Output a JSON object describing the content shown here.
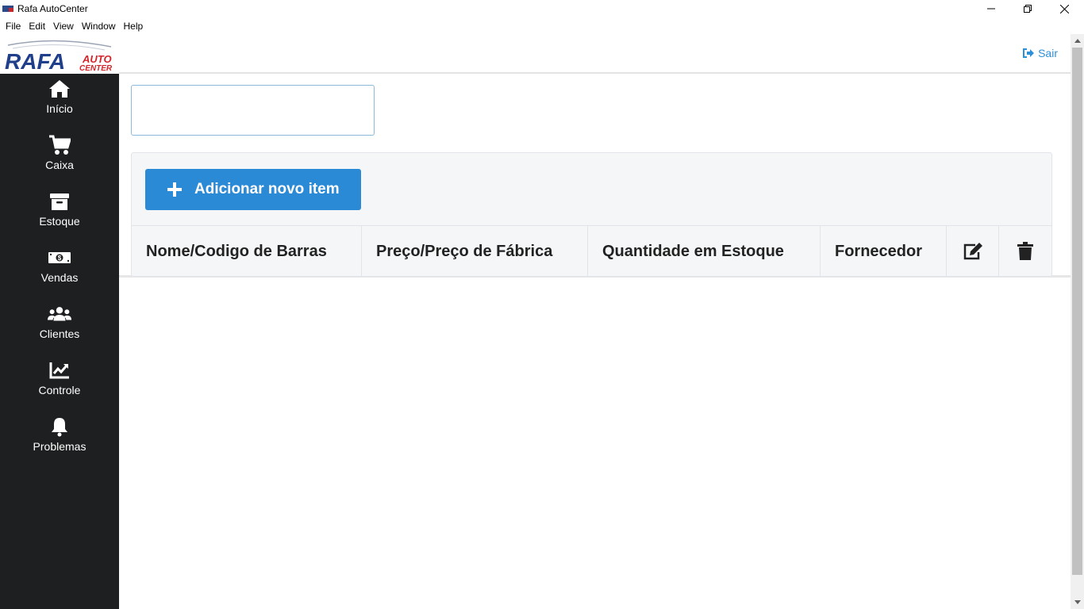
{
  "window": {
    "title": "Rafa AutoCenter"
  },
  "menu": [
    "File",
    "Edit",
    "View",
    "Window",
    "Help"
  ],
  "logo": {
    "main": "RAFA",
    "line1": "AUTO",
    "line2": "CENTER"
  },
  "sidebar": {
    "items": [
      {
        "label": "Início",
        "icon": "home-icon"
      },
      {
        "label": "Caixa",
        "icon": "shopping-cart-icon"
      },
      {
        "label": "Estoque",
        "icon": "archive-box-icon"
      },
      {
        "label": "Vendas",
        "icon": "money-bill-icon"
      },
      {
        "label": "Clientes",
        "icon": "users-icon"
      },
      {
        "label": "Controle",
        "icon": "chart-line-icon"
      },
      {
        "label": "Problemas",
        "icon": "bell-icon"
      }
    ]
  },
  "header": {
    "logout_label": "Sair"
  },
  "search": {
    "value": "",
    "placeholder": ""
  },
  "toolbar": {
    "add_label": "Adicionar novo item"
  },
  "table": {
    "columns": [
      "Nome/Codigo de Barras",
      "Preço/Preço de Fábrica",
      "Quantidade em Estoque",
      "Fornecedor"
    ],
    "action_columns": [
      "edit-icon",
      "trash-icon"
    ],
    "rows": []
  },
  "colors": {
    "sidebar_bg": "#1e1f21",
    "accent": "#2b8ad6",
    "link": "#2d8fd6"
  }
}
